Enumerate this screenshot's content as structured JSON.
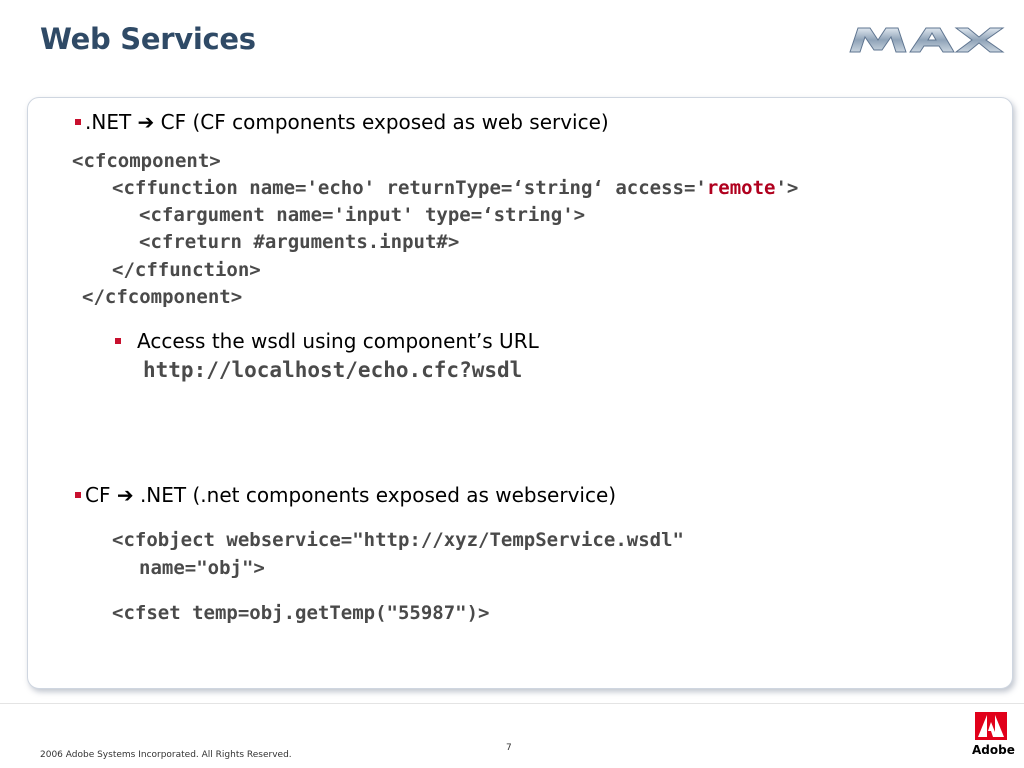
{
  "slide": {
    "title": "Web Services",
    "page_number": "7",
    "copyright": "2006 Adobe Systems Incorporated.  All Rights Reserved.",
    "brand": "Adobe"
  },
  "section1": {
    "prefix": ".NET ",
    "arrow": "➔",
    "suffix": " CF (CF components exposed as web service)",
    "code": [
      "<cfcomponent>",
      "<cffunction name='echo' returnType=‘string‘ access='",
      "remote",
      "'>",
      "<cfargument name='input' type=‘string'>",
      "<cfreturn #arguments.input#>",
      "</cffunction>",
      "</cfcomponent>"
    ],
    "sub_bullet": "Access the wsdl using component’s URL",
    "url": "http://localhost/echo.cfc?wsdl"
  },
  "section2": {
    "prefix": "CF  ",
    "arrow": "➔",
    "suffix": " .NET (.net components exposed as webservice)",
    "code": [
      "<cfobject webservice=\"http://xyz/TempService.wsdl\"",
      "name=\"obj\">",
      "<cfset temp=obj.getTemp(\"55987\")>"
    ]
  },
  "colors": {
    "title": "#2f4a66",
    "bullet": "#c8102e",
    "code": "#4a4a4a",
    "highlight": "#b0001e"
  },
  "icons": {
    "max": "max-logo-icon",
    "adobe": "adobe-logo-icon"
  }
}
